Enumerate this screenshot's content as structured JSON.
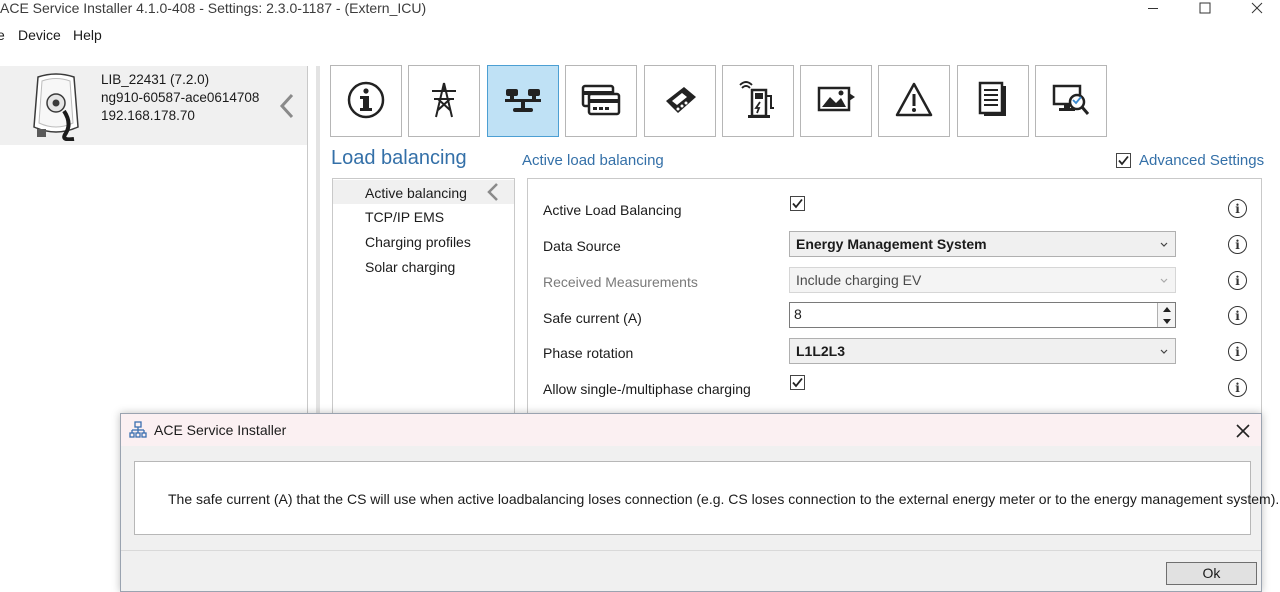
{
  "window": {
    "title": "ACE Service Installer 4.1.0-408 - Settings: 2.3.0-1187 -  (Extern_ICU)",
    "controls": [
      "minimize-icon",
      "maximize-icon",
      "close-icon"
    ]
  },
  "menu": {
    "items": [
      "e",
      "Device",
      "Help"
    ]
  },
  "device": {
    "name": "LIB_22431 (7.2.0)",
    "id": "ng910-60587-ace0614708",
    "ip": "192.168.178.70",
    "image_icon": "charging-station-icon",
    "collapse_icon": "chevron-left-icon"
  },
  "toolbar": {
    "active_index": 2,
    "buttons": [
      {
        "icon": "info-icon"
      },
      {
        "icon": "power-pylon-icon"
      },
      {
        "icon": "load-balancing-icon"
      },
      {
        "icon": "rfid-card-icon"
      },
      {
        "icon": "payment-terminal-icon"
      },
      {
        "icon": "charger-network-icon"
      },
      {
        "icon": "display-image-icon"
      },
      {
        "icon": "warning-icon"
      },
      {
        "icon": "document-icon"
      },
      {
        "icon": "monitor-search-icon"
      }
    ]
  },
  "section": {
    "title": "Load balancing",
    "subtitle": "Active load balancing",
    "advanced_settings": {
      "label": "Advanced Settings",
      "checked": true
    }
  },
  "nav": {
    "items": [
      "Active balancing",
      "TCP/IP EMS",
      "Charging profiles",
      "Solar charging"
    ],
    "active": "Active balancing"
  },
  "form": {
    "fields": [
      {
        "label": "Active Load Balancing",
        "type": "checkbox",
        "checked": true
      },
      {
        "label": "Data Source",
        "type": "select",
        "value": "Energy Management System"
      },
      {
        "label": "Received Measurements",
        "type": "select",
        "value": "Include charging EV",
        "disabled": true
      },
      {
        "label": "Safe current (A)",
        "type": "number",
        "value": "8"
      },
      {
        "label": "Phase rotation",
        "type": "select",
        "value": "L1L2L3"
      },
      {
        "label": "Allow single-/multiphase charging",
        "type": "checkbox",
        "checked": true
      }
    ]
  },
  "dialog": {
    "title": "ACE Service Installer",
    "message": "The safe current (A) that the CS will use when active loadbalancing loses connection (e.g. CS loses connection to the external energy meter or to the energy management system).",
    "ok_label": "Ok"
  }
}
